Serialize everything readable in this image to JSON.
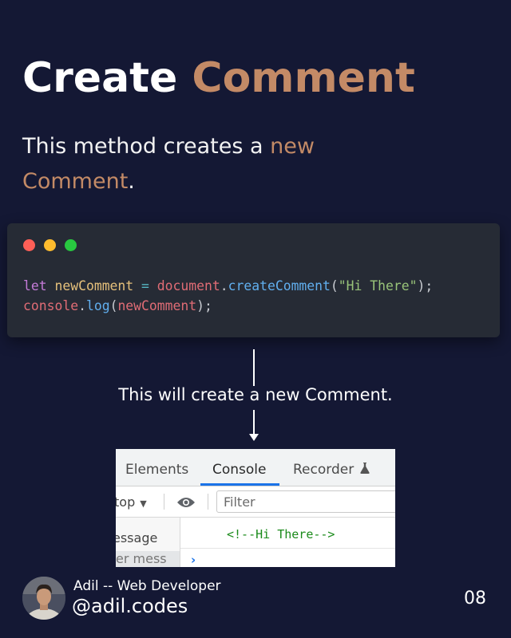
{
  "title": {
    "part1": "Create",
    "part2": "Comment"
  },
  "subtitle": {
    "text1": "This method creates a",
    "accent1": "new",
    "accent2": "Comment",
    "end": "."
  },
  "code": {
    "line1": {
      "kw": "let",
      "var": "newComment",
      "op": "=",
      "obj": "document",
      "dot": ".",
      "fn": "createComment",
      "lparen": "(",
      "str": "\"Hi There\"",
      "rparen": ");"
    },
    "line2": {
      "obj": "console",
      "dot": ".",
      "fn": "log",
      "lparen": "(",
      "arg": "newComment",
      "rparen": ");"
    }
  },
  "caption": "This will create a new Comment.",
  "devtools": {
    "tabs": [
      "Elements",
      "Console",
      "Recorder"
    ],
    "context": "top",
    "filter_placeholder": "Filter",
    "sidebar": [
      "essage",
      "er mess"
    ],
    "output": "<!--Hi There-->",
    "prompt": "›"
  },
  "author": {
    "name": "Adil -- Web Developer",
    "handle": "@adil.codes"
  },
  "page_number": "08",
  "colors": {
    "background": "#141834",
    "accent": "#c38a66",
    "code_bg": "#262b35"
  },
  "icons": [
    "window-red-dot",
    "window-yellow-dot",
    "window-green-dot",
    "flask-icon",
    "eye-icon",
    "dropdown-caret-icon",
    "console-prompt-icon"
  ]
}
